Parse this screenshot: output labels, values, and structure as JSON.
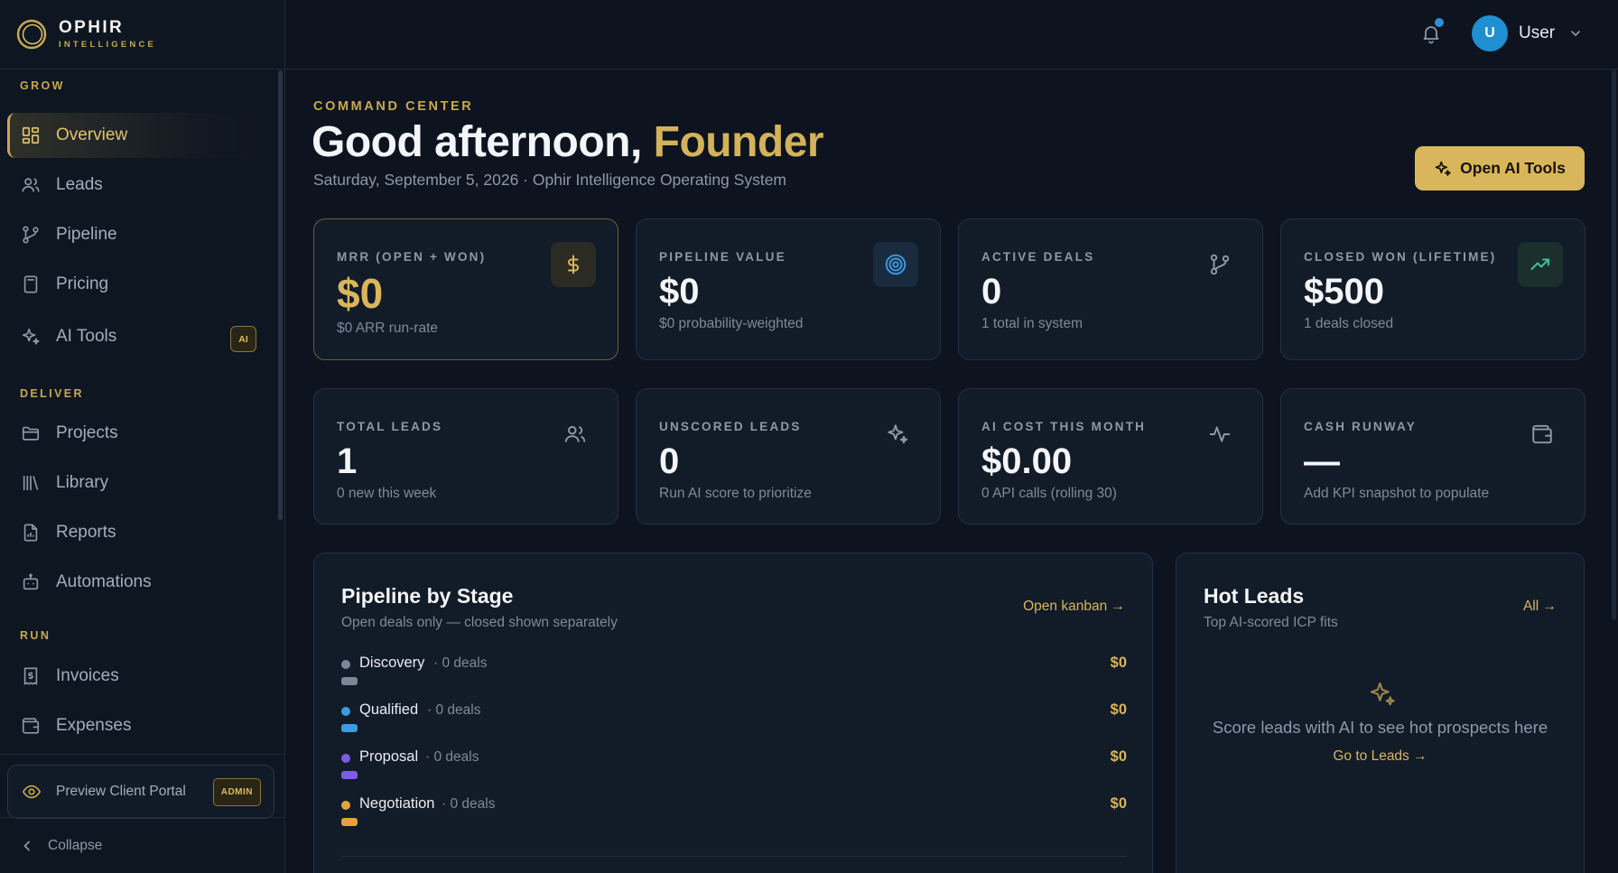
{
  "brand": {
    "name": "OPHIR",
    "sub": "INTELLIGENCE"
  },
  "sidebar": {
    "sections": [
      {
        "label": "GROW"
      },
      {
        "label": "DELIVER"
      },
      {
        "label": "RUN"
      }
    ],
    "items": [
      {
        "label": "Overview",
        "icon": "grid-icon",
        "active": true
      },
      {
        "label": "Leads",
        "icon": "users-icon"
      },
      {
        "label": "Pipeline",
        "icon": "git-branch-icon"
      },
      {
        "label": "Pricing",
        "icon": "calculator-icon"
      },
      {
        "label": "AI Tools",
        "icon": "sparkles-icon",
        "badge": "AI"
      },
      {
        "label": "Projects",
        "icon": "folder-icon"
      },
      {
        "label": "Library",
        "icon": "library-icon"
      },
      {
        "label": "Reports",
        "icon": "file-chart-icon"
      },
      {
        "label": "Automations",
        "icon": "bot-icon"
      },
      {
        "label": "Invoices",
        "icon": "receipt-icon"
      },
      {
        "label": "Expenses",
        "icon": "wallet-icon"
      }
    ],
    "portal": {
      "label": "Preview Client Portal",
      "badge": "ADMIN"
    },
    "collapse_label": "Collapse"
  },
  "topbar": {
    "user_initial": "U",
    "user_name": "User",
    "has_notification": true
  },
  "header": {
    "eyebrow": "COMMAND CENTER",
    "greeting": "Good afternoon, ",
    "greeting_name": "Founder",
    "date": "Saturday, September 5, 2026 ·",
    "system": "Ophir Intelligence Operating System",
    "ai_button": "Open AI Tools"
  },
  "kpis": [
    {
      "label": "MRR (OPEN + WON)",
      "value": "$0",
      "note": "$0 ARR run-rate",
      "icon": "dollar-icon"
    },
    {
      "label": "PIPELINE VALUE",
      "value": "$0",
      "note": "$0 probability-weighted",
      "icon": "target-icon"
    },
    {
      "label": "ACTIVE DEALS",
      "value": "0",
      "note": "1 total in system",
      "icon": "git-branch-icon"
    },
    {
      "label": "CLOSED WON (LIFETIME)",
      "value": "$500",
      "note": "1 deals closed",
      "icon": "trending-up-icon"
    },
    {
      "label": "TOTAL LEADS",
      "value": "1",
      "note": "0 new this week",
      "icon": "users-icon"
    },
    {
      "label": "UNSCORED LEADS",
      "value": "0",
      "note": "Run AI score to prioritize",
      "icon": "sparkles-icon"
    },
    {
      "label": "AI COST THIS MONTH",
      "value": "$0.00",
      "note": "0 API calls (rolling 30)",
      "icon": "activity-icon"
    },
    {
      "label": "CASH RUNWAY",
      "value": "—",
      "note": "Add KPI snapshot to populate",
      "icon": "wallet-icon"
    }
  ],
  "pipeline": {
    "title": "Pipeline by Stage",
    "subtitle": "Open deals only — closed shown separately",
    "link": "Open kanban →",
    "stages": [
      {
        "name": "Discovery",
        "count": "· 0 deals",
        "amount": "$0",
        "color": "#7d8696"
      },
      {
        "name": "Qualified",
        "count": "· 0 deals",
        "amount": "$0",
        "color": "#3b9be3"
      },
      {
        "name": "Proposal",
        "count": "· 0 deals",
        "amount": "$0",
        "color": "#7c5ce6"
      },
      {
        "name": "Negotiation",
        "count": "· 0 deals",
        "amount": "$0",
        "color": "#e3a338"
      }
    ]
  },
  "hot_leads": {
    "title": "Hot Leads",
    "subtitle": "Top AI-scored ICP fits",
    "link": "All →",
    "empty_text": "Score leads with AI to see hot prospects here",
    "empty_link": "Go to Leads →"
  }
}
